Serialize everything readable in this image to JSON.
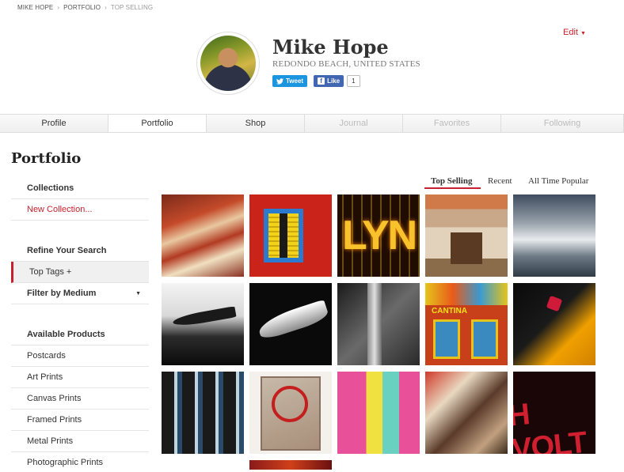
{
  "breadcrumb": {
    "items": [
      "MIKE HOPE",
      "PORTFOLIO",
      "TOP SELLING"
    ],
    "separator": "›"
  },
  "header": {
    "edit_label": "Edit",
    "name": "Mike Hope",
    "location": "REDONDO BEACH, UNITED STATES",
    "tweet_label": "Tweet",
    "like_label": "Like",
    "like_count": "1"
  },
  "tabs": [
    {
      "label": "Profile",
      "active": false,
      "enabled": true
    },
    {
      "label": "Portfolio",
      "active": true,
      "enabled": true
    },
    {
      "label": "Shop",
      "active": false,
      "enabled": true
    },
    {
      "label": "Journal",
      "active": false,
      "enabled": false
    },
    {
      "label": "Favorites",
      "active": false,
      "enabled": false
    },
    {
      "label": "Following",
      "active": false,
      "enabled": false
    }
  ],
  "page": {
    "title": "Portfolio"
  },
  "sidebar": {
    "collections_heading": "Collections",
    "new_collection": "New Collection...",
    "refine_heading": "Refine Your Search",
    "top_tags": "Top Tags +",
    "filter_medium": "Filter by Medium",
    "products_heading": "Available Products",
    "products": [
      "Postcards",
      "Art Prints",
      "Canvas Prints",
      "Framed Prints",
      "Metal Prints",
      "Photographic Prints"
    ]
  },
  "sort": {
    "options": [
      "Top Selling",
      "Recent",
      "All Time Popular"
    ],
    "active": "Top Selling"
  },
  "thumbnails": [
    {
      "name": "thumb-eyeglasses-scrabble"
    },
    {
      "name": "thumb-yellow-window-red-wall"
    },
    {
      "name": "thumb-lyn-neon-sign"
    },
    {
      "name": "thumb-building-facade"
    },
    {
      "name": "thumb-surf-waves"
    },
    {
      "name": "thumb-car-hood-ornament-bw"
    },
    {
      "name": "thumb-jet-hood-ornament"
    },
    {
      "name": "thumb-tower-bw"
    },
    {
      "name": "thumb-cantina-storefront"
    },
    {
      "name": "thumb-taxi-dice"
    },
    {
      "name": "thumb-tiki-surfboards"
    },
    {
      "name": "thumb-enter-at-own-risk-sign"
    },
    {
      "name": "thumb-pop-art-collage"
    },
    {
      "name": "thumb-graffiti-wall"
    },
    {
      "name": "thumb-high-voltage-sign"
    },
    {
      "name": "thumb-red-partial"
    }
  ],
  "colors": {
    "accent_red": "#c8202c",
    "twitter_blue": "#1b95e0",
    "facebook_blue": "#4267b2"
  },
  "icons": {
    "tweet": "twitter-bird-icon",
    "like": "facebook-f-icon",
    "edit_dropdown": "caret-down-icon",
    "medium_dropdown": "caret-down-icon"
  }
}
